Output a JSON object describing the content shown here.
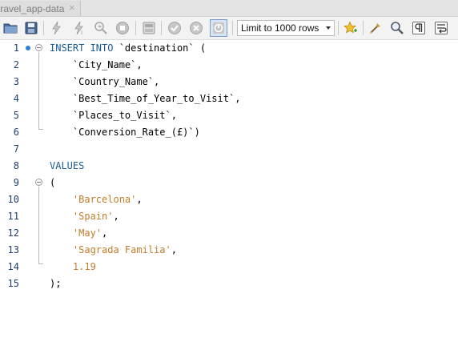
{
  "tab": {
    "title": "travel_app-data",
    "close": "×"
  },
  "toolbar": {
    "limit_label": "Limit to 1000 rows",
    "buttons": [
      "open-file-icon",
      "save-icon",
      "execute-icon",
      "execute-current-icon",
      "explain-icon",
      "stop-icon",
      "toggle-result-icon",
      "commit-icon",
      "rollback-icon",
      "autocommit-icon",
      "add-snippet-icon",
      "beautify-icon",
      "find-icon",
      "invisible-chars-icon",
      "wrap-lines-icon"
    ]
  },
  "editor": {
    "line_numbers": [
      "1",
      "2",
      "3",
      "4",
      "5",
      "6",
      "7",
      "8",
      "9",
      "10",
      "11",
      "12",
      "13",
      "14",
      "15"
    ],
    "lines": [
      [
        {
          "t": "INSERT INTO",
          "c": "kw"
        },
        {
          "t": " `destination` (",
          "c": ""
        }
      ],
      [
        {
          "t": "    `City_Name`,",
          "c": ""
        }
      ],
      [
        {
          "t": "    `Country_Name`,",
          "c": ""
        }
      ],
      [
        {
          "t": "    `Best_Time_of_Year_to_Visit`,",
          "c": ""
        }
      ],
      [
        {
          "t": "    `Places_to_Visit`,",
          "c": ""
        }
      ],
      [
        {
          "t": "    `Conversion_Rate_(£)`)",
          "c": ""
        }
      ],
      [
        {
          "t": "",
          "c": ""
        }
      ],
      [
        {
          "t": "VALUES",
          "c": "kw"
        }
      ],
      [
        {
          "t": "(",
          "c": ""
        }
      ],
      [
        {
          "t": "    ",
          "c": ""
        },
        {
          "t": "'Barcelona'",
          "c": "str"
        },
        {
          "t": ",",
          "c": ""
        }
      ],
      [
        {
          "t": "    ",
          "c": ""
        },
        {
          "t": "'Spain'",
          "c": "str"
        },
        {
          "t": ",",
          "c": ""
        }
      ],
      [
        {
          "t": "    ",
          "c": ""
        },
        {
          "t": "'May'",
          "c": "str"
        },
        {
          "t": ",",
          "c": ""
        }
      ],
      [
        {
          "t": "    ",
          "c": ""
        },
        {
          "t": "'Sagrada Familia'",
          "c": "str"
        },
        {
          "t": ",",
          "c": ""
        }
      ],
      [
        {
          "t": "    ",
          "c": ""
        },
        {
          "t": "1.19",
          "c": "num"
        }
      ],
      [
        {
          "t": ");",
          "c": ""
        }
      ]
    ]
  }
}
